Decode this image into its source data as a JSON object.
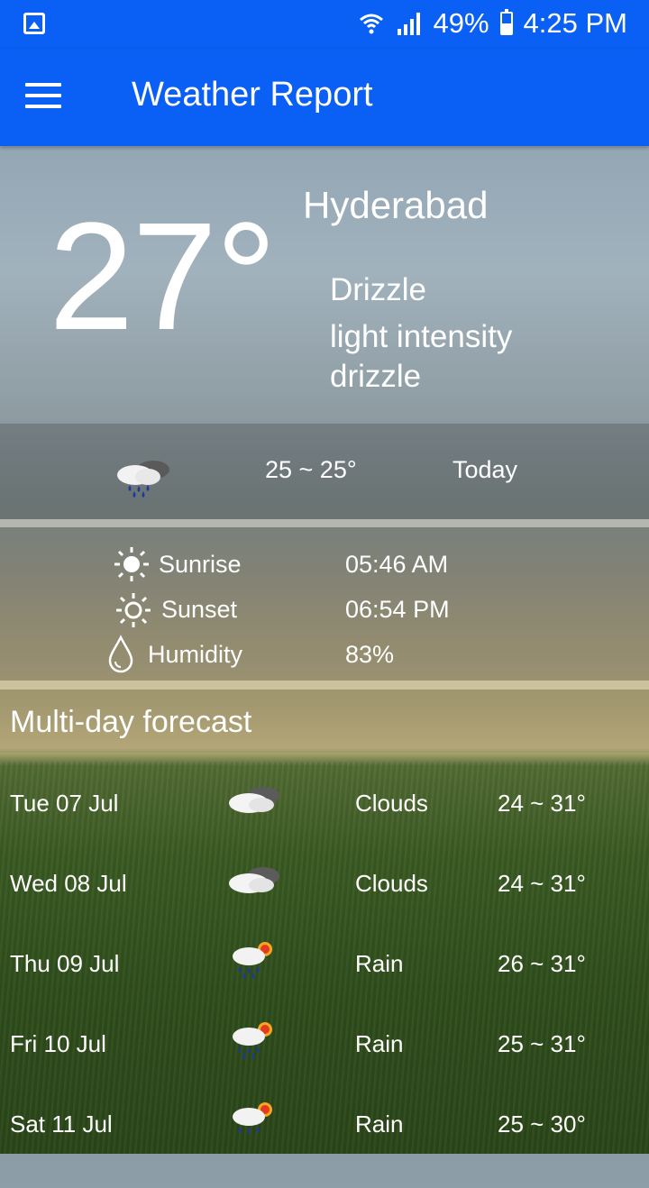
{
  "status_bar": {
    "battery": "49%",
    "time": "4:25 PM",
    "icons": [
      "gallery-icon",
      "wifi-icon",
      "signal-icon",
      "battery-icon"
    ]
  },
  "app_bar": {
    "title": "Weather Report",
    "menu_icon": "hamburger-menu-icon"
  },
  "current": {
    "temperature": "27°",
    "city": "Hyderabad",
    "condition": "Drizzle",
    "description": "light intensity drizzle"
  },
  "today": {
    "icon": "rain-cloud-icon",
    "range": "25 ~ 25°",
    "label": "Today"
  },
  "details": [
    {
      "icon": "sunrise-icon",
      "label": "Sunrise",
      "value": "05:46 AM"
    },
    {
      "icon": "sunset-icon",
      "label": "Sunset",
      "value": "06:54 PM"
    },
    {
      "icon": "humidity-drop-icon",
      "label": "Humidity",
      "value": "83%"
    }
  ],
  "forecast": {
    "title": "Multi-day forecast",
    "days": [
      {
        "date": "Tue  07 Jul",
        "icon": "clouds-icon",
        "condition": "Clouds",
        "range": "24 ~ 31°"
      },
      {
        "date": "Wed  08 Jul",
        "icon": "clouds-icon",
        "condition": "Clouds",
        "range": "24 ~ 31°"
      },
      {
        "date": "Thu  09 Jul",
        "icon": "rain-sun-icon",
        "condition": "Rain",
        "range": "26 ~ 31°"
      },
      {
        "date": "Fri  10 Jul",
        "icon": "rain-sun-icon",
        "condition": "Rain",
        "range": "25 ~ 31°"
      },
      {
        "date": "Sat  11 Jul",
        "icon": "rain-sun-icon",
        "condition": "Rain",
        "range": "25 ~ 30°"
      }
    ]
  },
  "colors": {
    "app_bar": "#0a5ff5",
    "text": "#ffffff"
  }
}
